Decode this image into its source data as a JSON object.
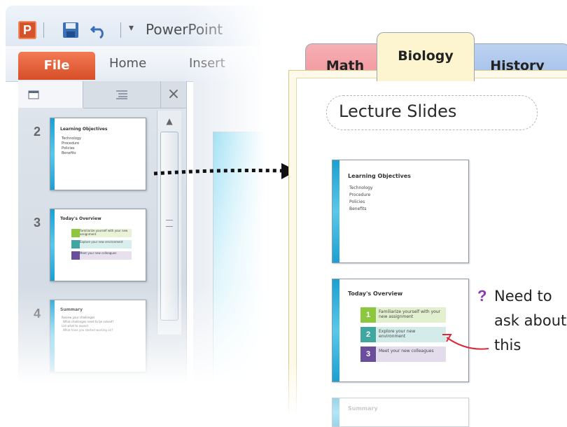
{
  "powerpoint": {
    "app_title": "PowerPoint",
    "logo_letter": "P",
    "ribbon_tabs": {
      "file": "File",
      "home": "Home",
      "insert": "Insert"
    },
    "close_glyph": "×",
    "slides": [
      {
        "number": "2",
        "title": "Learning Objectives",
        "bullets": [
          "Technology",
          "Procedure",
          "Policies",
          "Benefits"
        ]
      },
      {
        "number": "3",
        "title": "Today's Overview",
        "items": [
          "Familiarize yourself with your new assignment",
          "Explore your new environment",
          "Meet your new colleagues"
        ]
      },
      {
        "number": "4",
        "title": "Summary",
        "bullets": [
          "Review your challenges",
          "What challenges need to be solved?",
          "List what to expect",
          "What have you started working on?"
        ]
      }
    ]
  },
  "onenote": {
    "tabs": {
      "math": "Math",
      "biology": "Biology",
      "history": "History"
    },
    "page_title": "Lecture Slides",
    "slide1": {
      "title": "Learning Objectives",
      "bullets": [
        "Technology",
        "Procedure",
        "Policies",
        "Benefits"
      ]
    },
    "slide2": {
      "title": "Today's Overview",
      "items": [
        {
          "num": "1",
          "text": "Familiarize yourself with your new assignment",
          "color": "#8dc63f"
        },
        {
          "num": "2",
          "text": "Explore your new environment",
          "color": "#3fa7a0"
        },
        {
          "num": "3",
          "text": "Meet your new colleagues",
          "color": "#6b4e9b"
        }
      ]
    },
    "slide3": {
      "title": "Summary"
    },
    "note": {
      "mark": "?",
      "line1": "Need to",
      "line2": "ask about",
      "line3": "this"
    }
  },
  "colors": {
    "file_tab": "#e0592f",
    "math_tab": "#ef8c93",
    "biology_tab": "#fdf5cf",
    "history_tab": "#9ab9e7",
    "question_mark": "#8b3ab3",
    "red_arrow": "#d9283a"
  }
}
